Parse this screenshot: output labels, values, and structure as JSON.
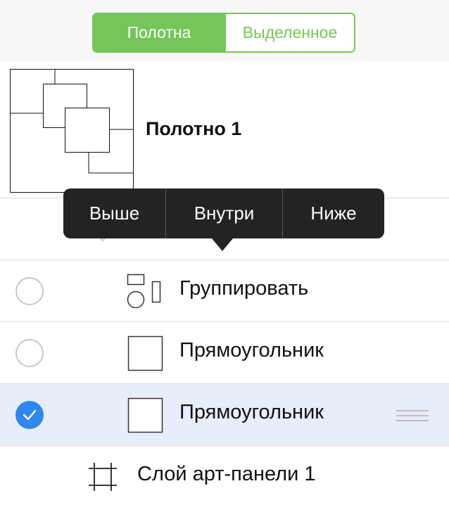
{
  "segmented": {
    "canvases_label": "Полотна",
    "selection_label": "Выделенное",
    "accent_color": "#76c55a"
  },
  "canvas": {
    "title": "Полотно 1"
  },
  "popover": {
    "above_label": "Выше",
    "inside_label": "Внутри",
    "below_label": "Ниже"
  },
  "layers": [
    {
      "label": "Группировать",
      "icon": "group-icon",
      "selected": false
    },
    {
      "label": "Прямоугольник",
      "icon": "rectangle-icon",
      "selected": false
    },
    {
      "label": "Прямоугольник",
      "icon": "rectangle-icon",
      "selected": true
    }
  ],
  "artboard_layer": {
    "label": "Слой арт-панели 1",
    "icon": "artboard-icon"
  },
  "colors": {
    "selection_blue": "#2f86ee",
    "selected_row_bg": "#e7eef9",
    "popover_bg": "#232323"
  }
}
